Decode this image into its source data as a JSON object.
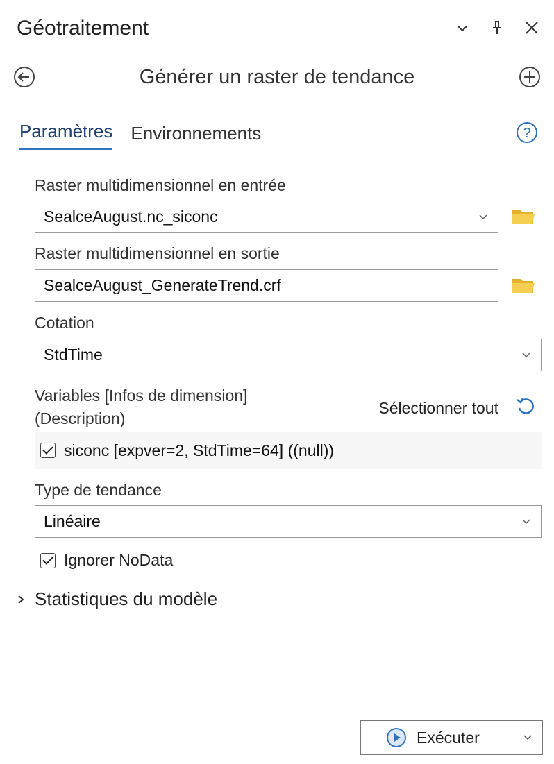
{
  "pane": {
    "title": "Géotraitement",
    "icons": [
      "chevron-down-icon",
      "pin-icon",
      "close-icon"
    ]
  },
  "nav": {
    "tool_title": "Générer un raster de tendance",
    "back_icon": "back-arrow-icon",
    "add_icon": "add-circle-icon"
  },
  "tabs": [
    {
      "label": "Paramètres",
      "active": true
    },
    {
      "label": "Environnements",
      "active": false
    }
  ],
  "help_icon": "help-icon",
  "form": {
    "input_raster": {
      "label": "Raster multidimensionnel en entrée",
      "value": "SealceAugust.nc_siconc"
    },
    "output_raster": {
      "label": "Raster multidimensionnel en sortie",
      "value": "SealceAugust_GenerateTrend.crf"
    },
    "dimension": {
      "label": "Cotation",
      "value": "StdTime"
    },
    "variables": {
      "label_line1": "Variables [Infos de dimension]",
      "label_line2": "(Description)",
      "select_all": "Sélectionner tout",
      "item": {
        "text": "siconc [expver=2, StdTime=64] ((null))",
        "checked": true
      }
    },
    "trend_type": {
      "label": "Type de tendance",
      "value": "Linéaire"
    },
    "ignore_nodata": {
      "label": "Ignorer NoData",
      "checked": true
    }
  },
  "stats": {
    "label": "Statistiques du modèle"
  },
  "run": {
    "label": "Exécuter"
  },
  "colors": {
    "accent": "#2f74c0",
    "folder": "#f2c53d",
    "text": "#222222"
  }
}
